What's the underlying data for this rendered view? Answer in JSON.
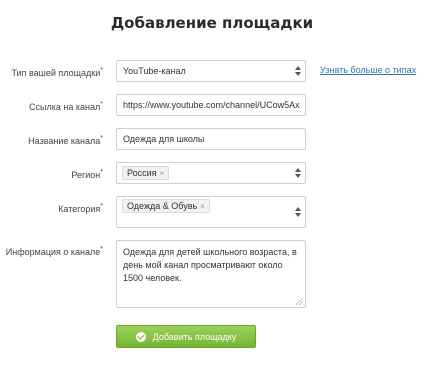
{
  "title": "Добавление площадки",
  "form": {
    "platform_type": {
      "label": "Тип вашей площадки",
      "value": "YouTube-канал"
    },
    "learn_more_link": "Узнать больше о типах",
    "channel_url": {
      "label": "Ссылка на канал",
      "value": "https://www.youtube.com/channel/UCow5Ax"
    },
    "channel_name": {
      "label": "Название канала",
      "value": "Одежда для школы"
    },
    "region": {
      "label": "Регион",
      "tag": "Россия"
    },
    "category": {
      "label": "Категория",
      "tag": "Одежда & Обувь"
    },
    "channel_info": {
      "label": "Информация о канале",
      "value": "Одежда для детей школьного возраста, в день мой канал просматривают около 1500 человек."
    },
    "required_mark": "*",
    "tag_remove": "×"
  },
  "submit_label": "Добавить площадку"
}
